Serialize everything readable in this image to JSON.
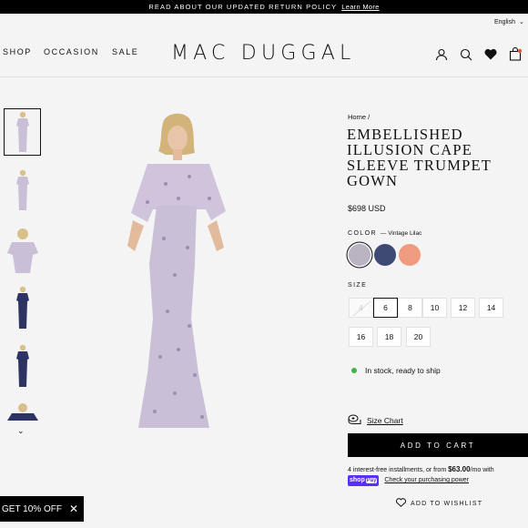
{
  "announcement": {
    "text": "READ ABOUT OUR UPDATED RETURN POLICY",
    "link": "Learn More"
  },
  "language": {
    "label": "English"
  },
  "nav": {
    "items": [
      "SHOP",
      "OCCASION",
      "SALE"
    ]
  },
  "logo": {
    "text": "MAC DUGGAL"
  },
  "header_icons": [
    "user-icon",
    "search-icon",
    "heart-icon",
    "bag-icon"
  ],
  "breadcrumb": {
    "home": "Home",
    "separator": "/"
  },
  "product": {
    "title": "EMBELLISHED ILLUSION CAPE SLEEVE TRUMPET GOWN",
    "price": "$698 USD",
    "color_label": "COLOR",
    "color_value": "— Vintage Lilac",
    "colors": [
      {
        "name": "Vintage Lilac",
        "hex": "#b9b3c2"
      },
      {
        "name": "Navy",
        "hex": "#3f4a74"
      },
      {
        "name": "Coral",
        "hex": "#ef9b80"
      }
    ],
    "size_label": "SIZE",
    "sizes": [
      "4",
      "6",
      "8",
      "10",
      "12",
      "14",
      "16",
      "18",
      "20"
    ],
    "selected_size": "6",
    "stock": "In stock, ready to ship",
    "size_chart": "Size Chart",
    "add_to_cart": "ADD TO CART",
    "installments_text": "4 interest-free installments, or from",
    "installments_amount": "$63.00",
    "installments_suffix": "/mo with",
    "shop_pay_shop": "shop",
    "shop_pay_pay": "Pay",
    "check_power": "Check your purchasing power",
    "wishlist": "ADD TO WISHLIST"
  },
  "promo": {
    "text": "GET 10% OFF"
  },
  "colors": {
    "accent": "#000000",
    "stock_green": "#3bb54a",
    "shoppay": "#5a31f4",
    "dress_lilac": "#c9bfd6",
    "dress_navy": "#2d3463"
  }
}
